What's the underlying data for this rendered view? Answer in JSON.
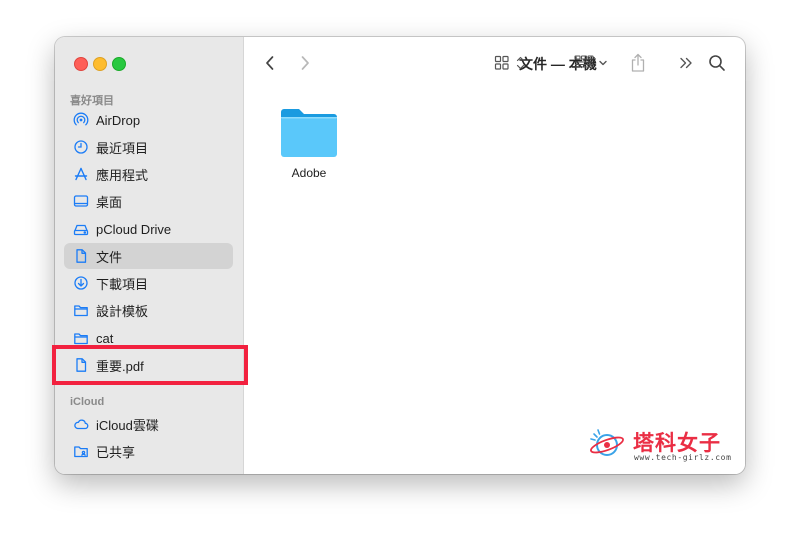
{
  "window": {
    "title": "文件 — 本機"
  },
  "sidebar": {
    "favorites_title": "喜好項目",
    "icloud_title": "iCloud",
    "favorites": [
      {
        "label": "AirDrop",
        "icon": "airdrop-icon"
      },
      {
        "label": "最近項目",
        "icon": "clock-icon"
      },
      {
        "label": "應用程式",
        "icon": "applications-icon"
      },
      {
        "label": "桌面",
        "icon": "desktop-icon"
      },
      {
        "label": "pCloud Drive",
        "icon": "drive-icon"
      },
      {
        "label": "文件",
        "icon": "document-icon",
        "selected": true
      },
      {
        "label": "下載項目",
        "icon": "download-icon"
      },
      {
        "label": "設計模板",
        "icon": "folder-icon"
      },
      {
        "label": "cat",
        "icon": "folder-icon"
      },
      {
        "label": "重要.pdf",
        "icon": "document-icon"
      }
    ],
    "icloud": [
      {
        "label": "iCloud雲碟",
        "icon": "cloud-icon"
      },
      {
        "label": "已共享",
        "icon": "shared-folder-icon"
      }
    ]
  },
  "content": {
    "files": [
      {
        "name": "Adobe",
        "icon": "folder-icon"
      }
    ]
  },
  "watermark": {
    "title": "塔科女子",
    "subtitle": "www.tech-girlz.com"
  },
  "colors": {
    "accent": "#1b7cf6",
    "folder": "#5ac8fa",
    "highlight": "#f2213f",
    "watermark": "#ea2e44"
  }
}
